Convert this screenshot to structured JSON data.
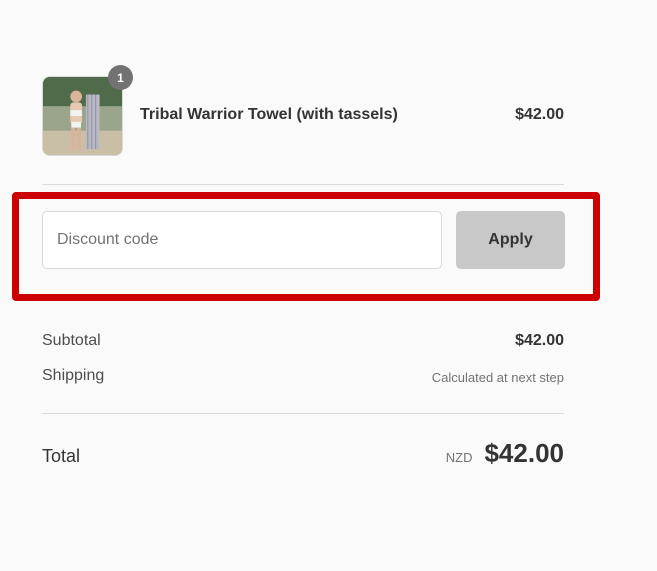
{
  "product": {
    "name": "Tribal Warrior Towel (with tassels)",
    "price": "$42.00",
    "quantity": "1",
    "image_icon": "product-photo-icon"
  },
  "discount": {
    "placeholder": "Discount code",
    "value": "",
    "apply_label": "Apply",
    "highlight_color": "#cc0000"
  },
  "summary": {
    "subtotal_label": "Subtotal",
    "subtotal_value": "$42.00",
    "shipping_label": "Shipping",
    "shipping_value": "Calculated at next step",
    "total_label": "Total",
    "currency": "NZD",
    "total_value": "$42.00"
  }
}
